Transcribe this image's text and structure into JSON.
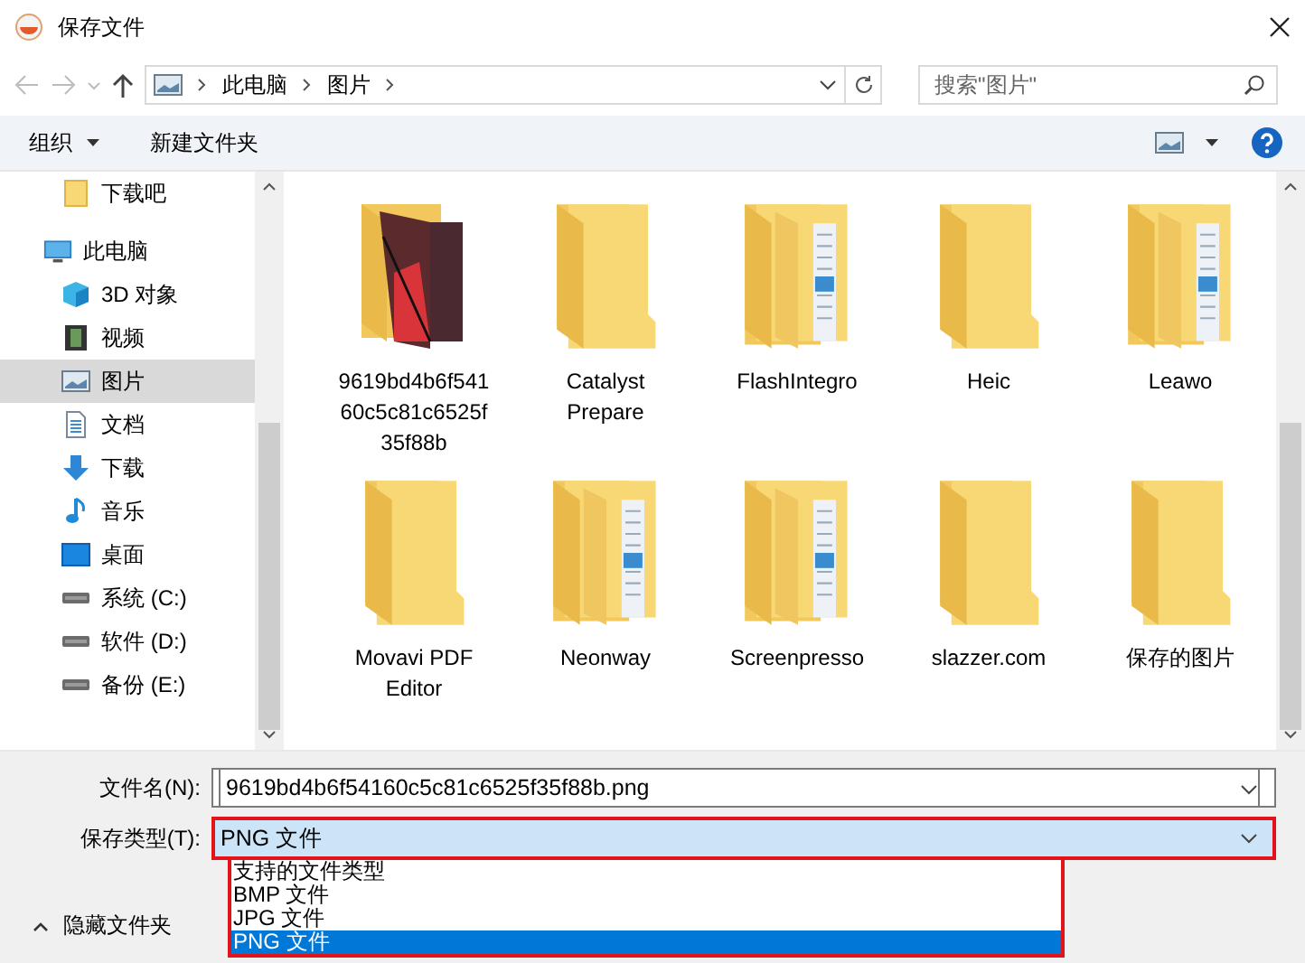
{
  "window": {
    "title": "保存文件"
  },
  "address_bar": {
    "path": [
      "此电脑",
      "图片"
    ]
  },
  "search": {
    "placeholder": "搜索\"图片\""
  },
  "toolbar": {
    "buttons": [
      {
        "label": "组织",
        "kind": "menu"
      },
      {
        "label": "新建文件夹",
        "kind": "plain"
      }
    ]
  },
  "sidebar": {
    "items": [
      {
        "label": "下载吧",
        "kind": "folder",
        "selected": false
      },
      {
        "label": "此电脑",
        "kind": "pc",
        "selected": false,
        "children": [
          {
            "label": "3D 对象",
            "kind": "cube",
            "selected": false
          },
          {
            "label": "视频",
            "kind": "film",
            "selected": false
          },
          {
            "label": "图片",
            "kind": "picture",
            "selected": true
          },
          {
            "label": "文档",
            "kind": "doc",
            "selected": false
          },
          {
            "label": "下载",
            "kind": "download",
            "selected": false
          },
          {
            "label": "音乐",
            "kind": "music",
            "selected": false
          },
          {
            "label": "桌面",
            "kind": "desktop",
            "selected": false
          },
          {
            "label": "系统 (C:)",
            "kind": "drive",
            "selected": false
          },
          {
            "label": "软件 (D:)",
            "kind": "drive",
            "selected": false
          },
          {
            "label": "备份 (E:)",
            "kind": "drive",
            "selected": false
          }
        ]
      }
    ]
  },
  "files": [
    {
      "name": "9619bd4b6f54160c5c81c6525f35f88b",
      "kind": "photo"
    },
    {
      "name": "Catalyst Prepare",
      "kind": "plain"
    },
    {
      "name": "FlashIntegro",
      "kind": "docs"
    },
    {
      "name": "Heic",
      "kind": "plain"
    },
    {
      "name": "Leawo",
      "kind": "docs"
    },
    {
      "name": "Movavi PDF Editor",
      "kind": "plain"
    },
    {
      "name": "Neonway",
      "kind": "docs"
    },
    {
      "name": "Screenpresso",
      "kind": "docs"
    },
    {
      "name": "slazzer.com",
      "kind": "plain"
    },
    {
      "name": "保存的图片",
      "kind": "plain"
    }
  ],
  "file_name": {
    "label": "文件名(N):",
    "value": "9619bd4b6f54160c5c81c6525f35f88b.png"
  },
  "save_type": {
    "label": "保存类型(T):",
    "value": "PNG 文件",
    "expanded": true,
    "options": [
      {
        "label": "支持的文件类型",
        "selected": false
      },
      {
        "label": "BMP 文件",
        "selected": false
      },
      {
        "label": "JPG 文件",
        "selected": false
      },
      {
        "label": "PNG 文件",
        "selected": true
      }
    ]
  },
  "hide_folders": {
    "label": "隐藏文件夹"
  }
}
